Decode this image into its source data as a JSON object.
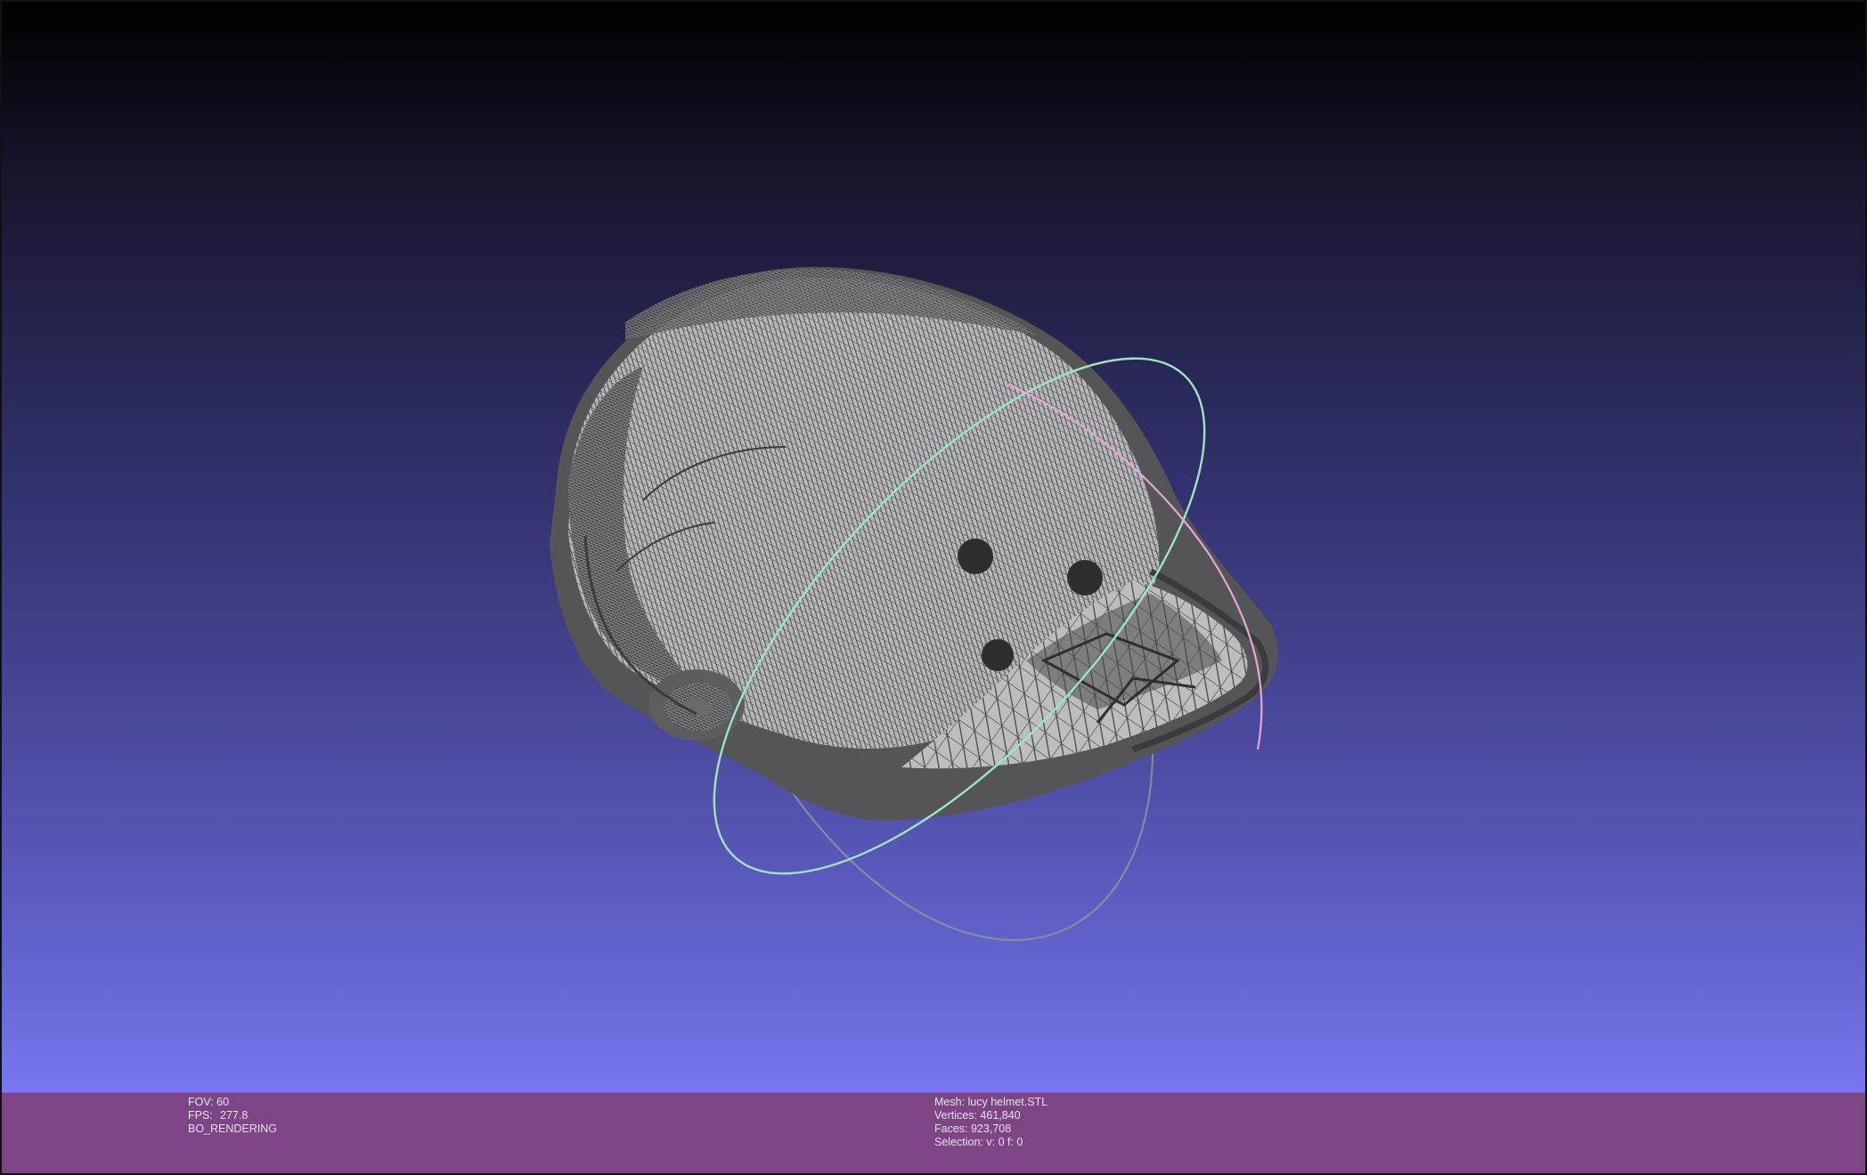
{
  "viewer": {
    "background_top": "#000000",
    "background_bottom": "#7877ef",
    "mesh_color": "#b9b9bd",
    "wire_color": "#474747",
    "trackball_colors": [
      "#8a8fa2",
      "#9fe3c0",
      "#e6a4d7"
    ]
  },
  "info_bar": {
    "color": "#7d4585",
    "left": {
      "fov": "FOV: 60",
      "fps_label": "FPS:",
      "fps_value": "277.8",
      "render_mode": "BO_RENDERING"
    },
    "right": {
      "mesh": "Mesh: lucy helmet.STL",
      "vertices": "Vertices: 461,840",
      "faces": "Faces: 923,708",
      "selection": "Selection: v: 0 f: 0"
    }
  }
}
